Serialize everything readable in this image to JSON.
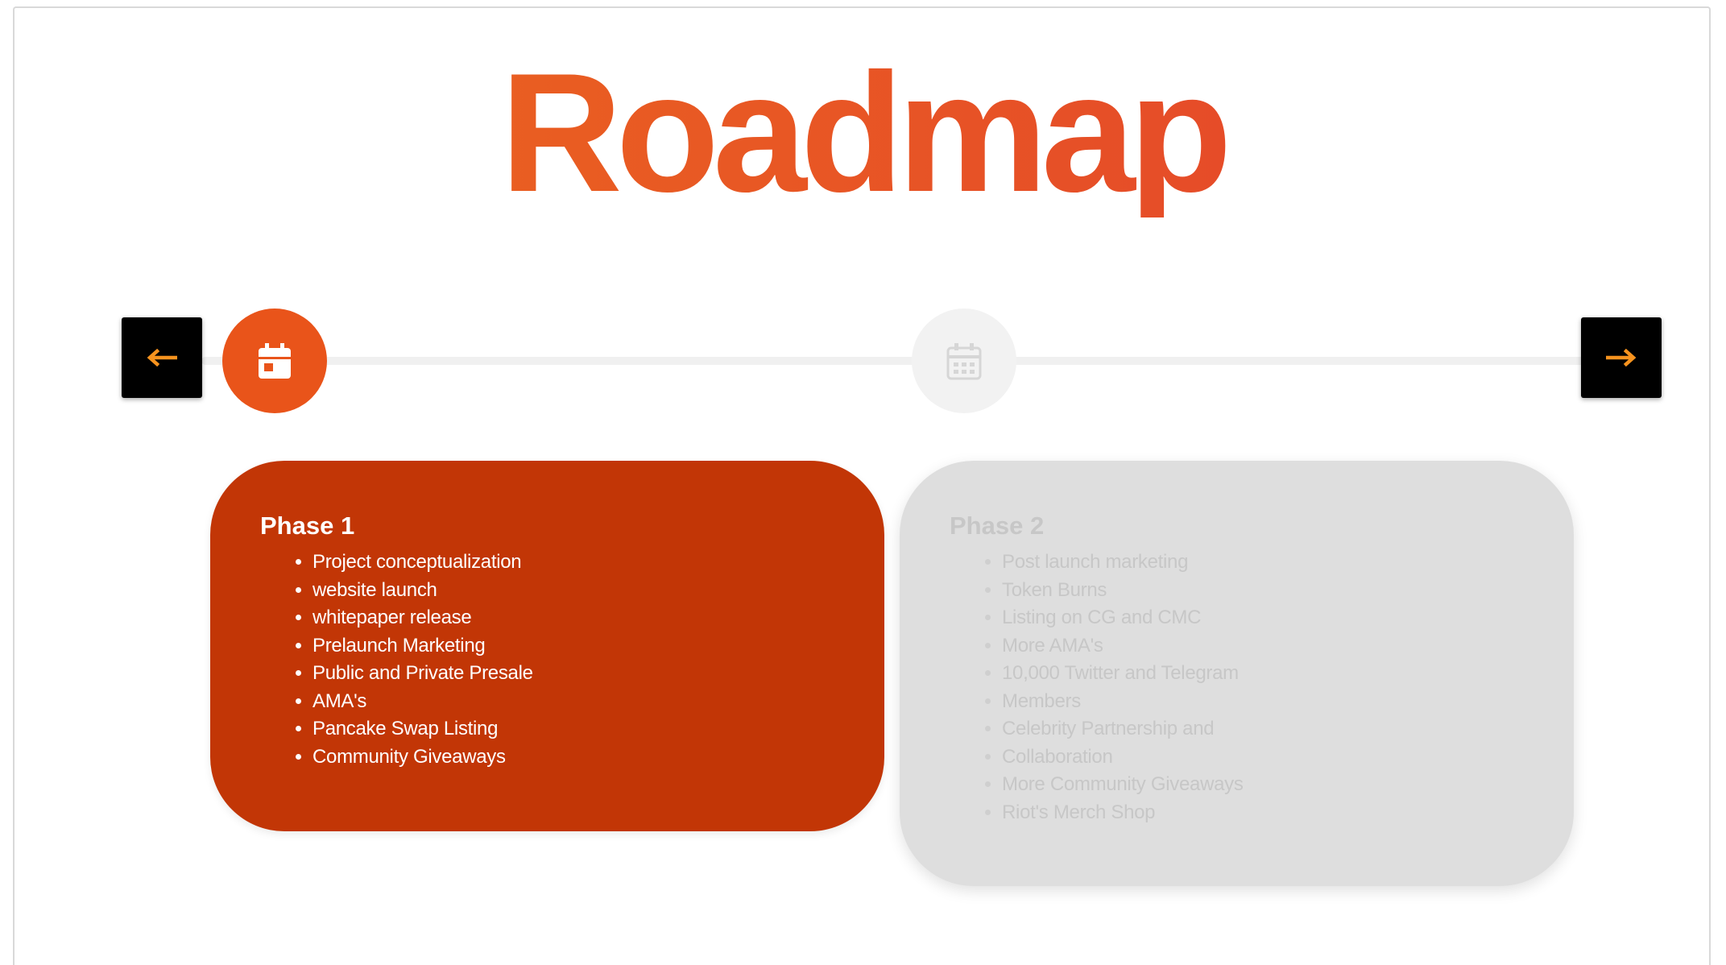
{
  "title": "Roadmap",
  "colors": {
    "title_gradient_start": "#ec6a1d",
    "title_gradient_end": "#e3402d",
    "active_marker": "#e9541a",
    "active_card": "#c23606",
    "inactive_card": "#dedede",
    "nav_button": "#000000",
    "nav_arrow": "#f7931e"
  },
  "nav": {
    "prev_icon": "arrow-left-icon",
    "next_icon": "arrow-right-icon"
  },
  "timeline": {
    "markers": [
      {
        "icon": "calendar-icon",
        "state": "active"
      },
      {
        "icon": "calendar-icon",
        "state": "inactive"
      }
    ]
  },
  "phases": [
    {
      "title": "Phase 1",
      "state": "active",
      "items": [
        "Project conceptualization",
        "website launch",
        "whitepaper release",
        "Prelaunch Marketing",
        "Public and Private Presale",
        "AMA's",
        "Pancake Swap Listing",
        "Community Giveaways"
      ]
    },
    {
      "title": "Phase 2",
      "state": "inactive",
      "items": [
        "Post launch marketing",
        "Token Burns",
        "Listing on CG and CMC",
        "More AMA's",
        "10,000 Twitter and Telegram",
        "Members",
        "Celebrity Partnership and",
        "Collaboration",
        "More Community Giveaways",
        "Riot's Merch Shop"
      ]
    }
  ]
}
